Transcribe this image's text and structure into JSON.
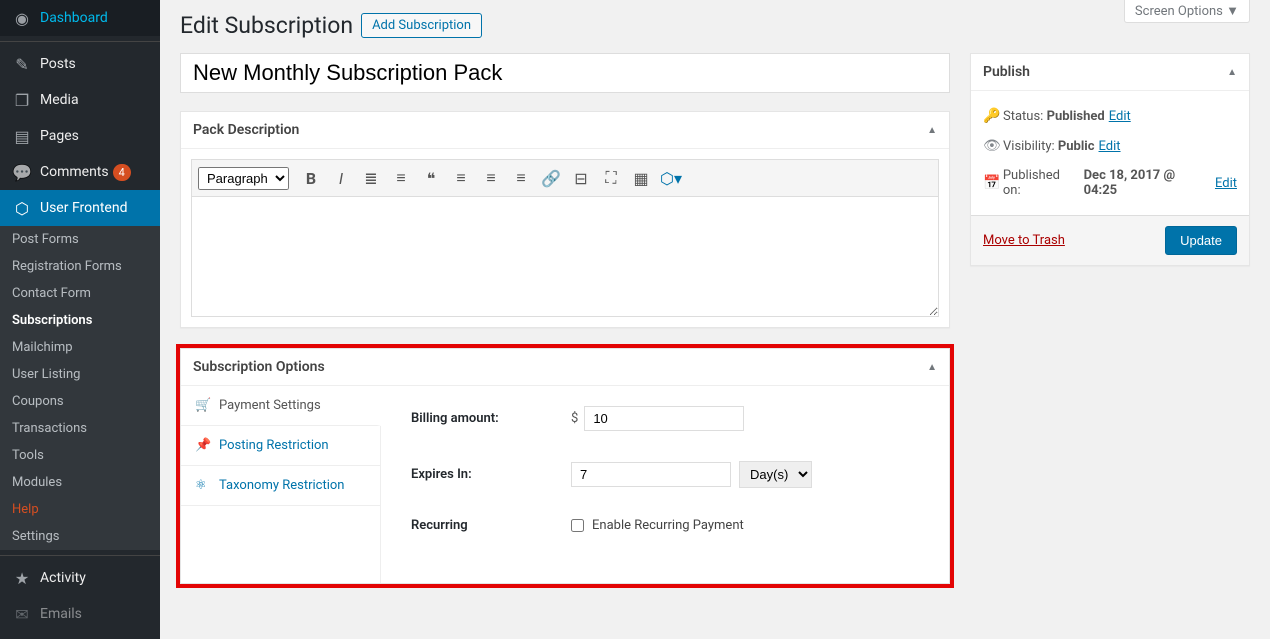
{
  "screen_options_label": "Screen Options",
  "page_title": "Edit Subscription",
  "add_button": "Add Subscription",
  "title_value": "New Monthly Subscription Pack",
  "sidebar": {
    "items": [
      {
        "label": "Dashboard",
        "icon": "◉"
      },
      {
        "label": "Posts",
        "icon": "✎"
      },
      {
        "label": "Media",
        "icon": "❐"
      },
      {
        "label": "Pages",
        "icon": "▤"
      },
      {
        "label": "Comments",
        "icon": "💬",
        "badge": "4"
      },
      {
        "label": "User Frontend",
        "icon": "⬡",
        "current": true
      }
    ],
    "sub": [
      {
        "label": "Post Forms"
      },
      {
        "label": "Registration Forms"
      },
      {
        "label": "Contact Form"
      },
      {
        "label": "Subscriptions",
        "current": true
      },
      {
        "label": "Mailchimp"
      },
      {
        "label": "User Listing"
      },
      {
        "label": "Coupons"
      },
      {
        "label": "Transactions"
      },
      {
        "label": "Tools"
      },
      {
        "label": "Modules"
      },
      {
        "label": "Help",
        "help": true
      },
      {
        "label": "Settings"
      }
    ],
    "lower": [
      {
        "label": "Activity",
        "icon": "★"
      },
      {
        "label": "Emails",
        "icon": "✉"
      }
    ]
  },
  "pack_description": {
    "title": "Pack Description",
    "paragraph_label": "Paragraph"
  },
  "subscription_options": {
    "title": "Subscription Options",
    "tabs": [
      {
        "label": "Payment Settings",
        "icon": "🛒"
      },
      {
        "label": "Posting Restriction",
        "icon": "📌"
      },
      {
        "label": "Taxonomy Restriction",
        "icon": "⚛"
      }
    ],
    "billing_label": "Billing amount:",
    "billing_currency": "$",
    "billing_value": "10",
    "expires_label": "Expires In:",
    "expires_value": "7",
    "expires_unit": "Day(s)",
    "recurring_label": "Recurring",
    "recurring_checkbox_label": "Enable Recurring Payment"
  },
  "publish": {
    "title": "Publish",
    "status_label": "Status:",
    "status_value": "Published",
    "visibility_label": "Visibility:",
    "visibility_value": "Public",
    "published_label": "Published on:",
    "published_value": "Dec 18, 2017 @ 04:25",
    "edit_label": "Edit",
    "trash_label": "Move to Trash",
    "update_label": "Update"
  }
}
